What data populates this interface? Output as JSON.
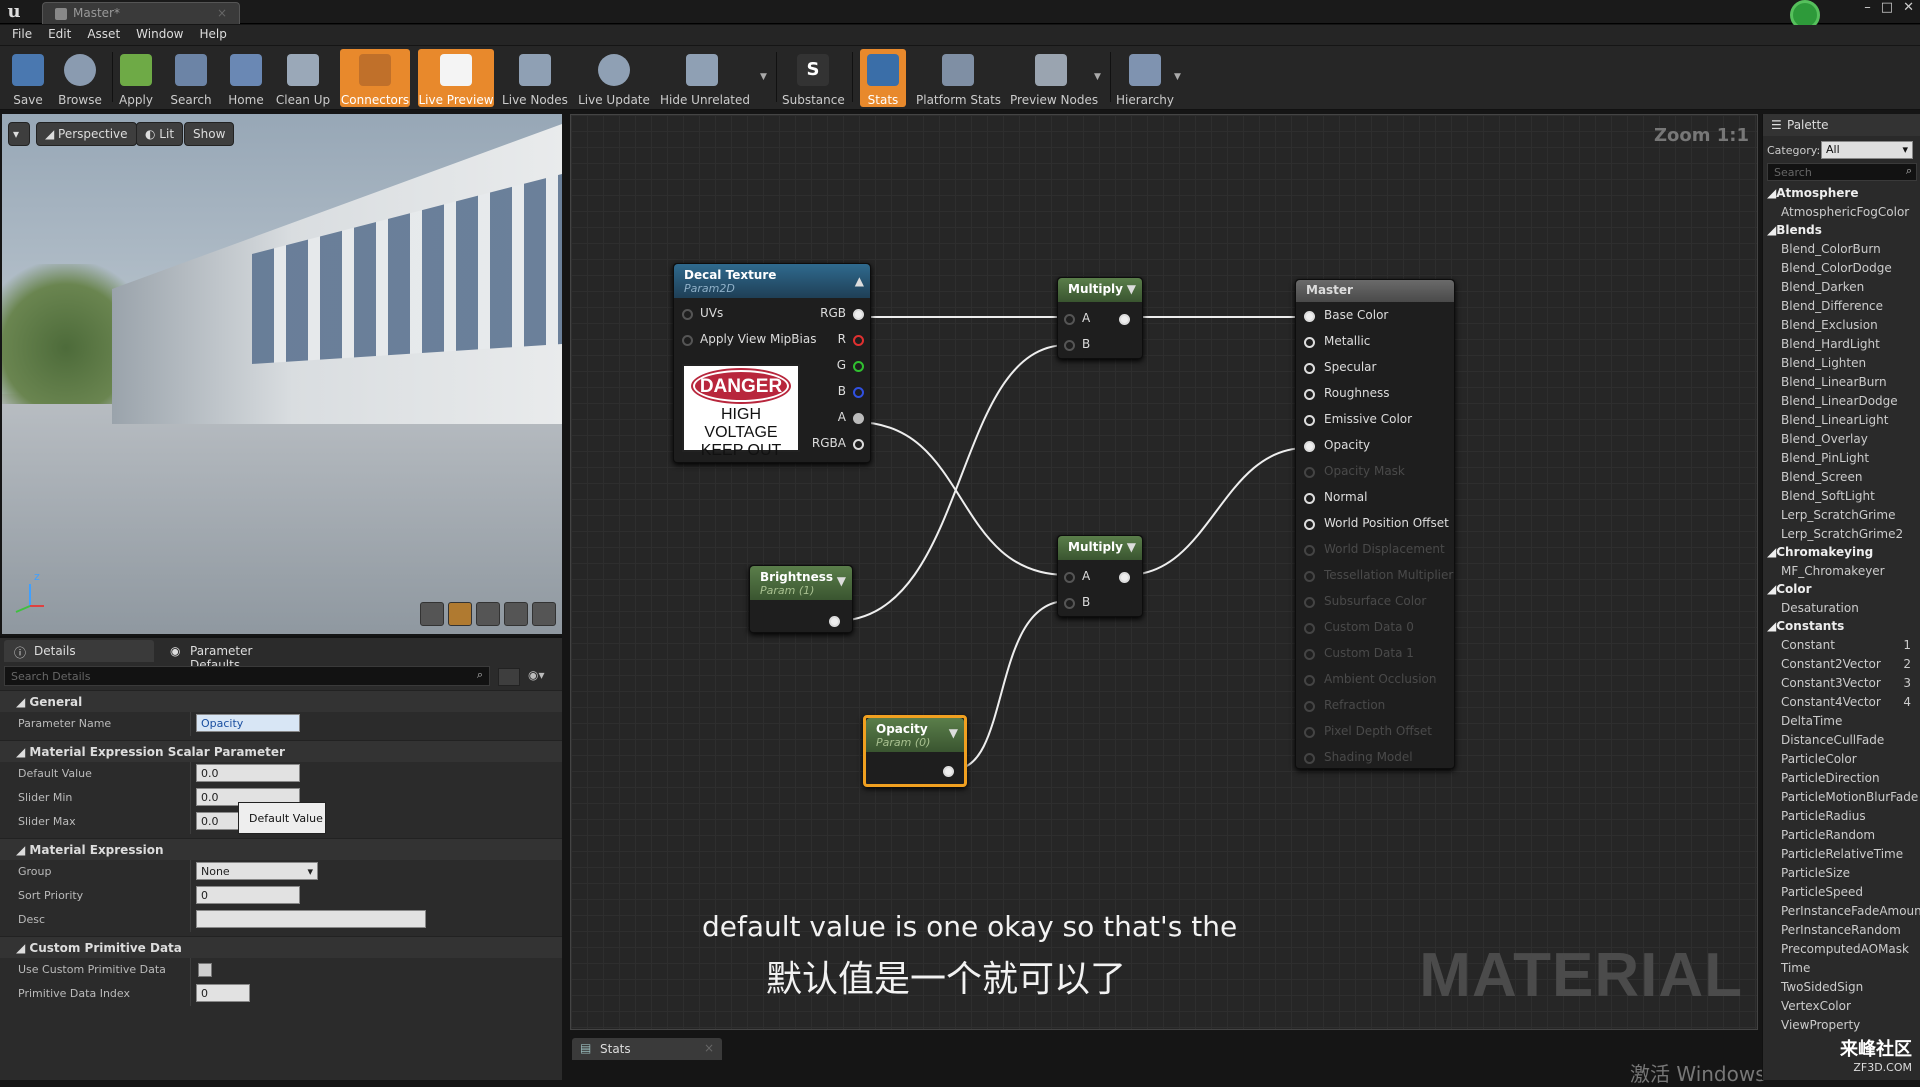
{
  "window": {
    "title": "Master*"
  },
  "menu": [
    "File",
    "Edit",
    "Asset",
    "Window",
    "Help"
  ],
  "toolbar": [
    {
      "label": "Save",
      "icon": "save-icon"
    },
    {
      "label": "Browse",
      "icon": "browse-icon"
    },
    {
      "label": "Apply",
      "icon": "apply-check-icon"
    },
    {
      "label": "Search",
      "icon": "search-icon"
    },
    {
      "label": "Home",
      "icon": "home-icon"
    },
    {
      "label": "Clean Up",
      "icon": "clean-up-icon"
    },
    {
      "label": "Connectors",
      "icon": "connectors-icon",
      "active": true
    },
    {
      "label": "Live Preview",
      "icon": "live-preview-icon",
      "active": true
    },
    {
      "label": "Live Nodes",
      "icon": "live-nodes-icon"
    },
    {
      "label": "Live Update",
      "icon": "live-update-icon"
    },
    {
      "label": "Hide Unrelated",
      "icon": "hide-unrelated-icon"
    },
    {
      "label": "Substance",
      "icon": "substance-icon"
    },
    {
      "label": "Stats",
      "icon": "stats-icon",
      "active": true
    },
    {
      "label": "Platform Stats",
      "icon": "platform-stats-icon"
    },
    {
      "label": "Preview Nodes",
      "icon": "preview-nodes-icon"
    },
    {
      "label": "Hierarchy",
      "icon": "hierarchy-icon"
    }
  ],
  "viewport": {
    "perspective": "Perspective",
    "lit": "Lit",
    "show": "Show",
    "axis": "z"
  },
  "details": {
    "tabs": [
      "Details",
      "Parameter Defaults"
    ],
    "search_placeholder": "Search Details",
    "sections": {
      "general": "General",
      "scalar": "Material Expression Scalar Parameter",
      "expression": "Material Expression",
      "custom": "Custom Primitive Data"
    },
    "rows": {
      "param_name_label": "Parameter Name",
      "param_name_value": "Opacity",
      "default_label": "Default Value",
      "default_value": "0.0",
      "slider_min_label": "Slider Min",
      "slider_min_value": "0.0",
      "slider_max_label": "Slider Max",
      "slider_max_value": "0.0",
      "group_label": "Group",
      "group_value": "None",
      "sort_label": "Sort Priority",
      "sort_value": "0",
      "desc_label": "Desc",
      "use_custom_label": "Use Custom Primitive Data",
      "prim_index_label": "Primitive Data Index",
      "prim_index_value": "0"
    },
    "tooltip": "Default Value"
  },
  "graph": {
    "zoom": "Zoom 1:1",
    "watermark": "MATERIAL",
    "decal": {
      "title": "Decal Texture",
      "subtitle": "Param2D",
      "in": [
        "UVs",
        "Apply View MipBias"
      ],
      "out": [
        "RGB",
        "R",
        "G",
        "B",
        "A",
        "RGBA"
      ],
      "sign": {
        "line1": "DANGER",
        "line2": "HIGH VOLTAGE",
        "line3": "KEEP OUT"
      }
    },
    "multiply1": {
      "title": "Multiply",
      "a": "A",
      "b": "B"
    },
    "multiply2": {
      "title": "Multiply",
      "a": "A",
      "b": "B"
    },
    "brightness": {
      "title": "Brightness",
      "subtitle": "Param (1)"
    },
    "opacity": {
      "title": "Opacity",
      "subtitle": "Param (0)"
    },
    "master": {
      "title": "Master",
      "pins": [
        {
          "label": "Base Color",
          "on": true
        },
        {
          "label": "Metallic",
          "on": true
        },
        {
          "label": "Specular",
          "on": true
        },
        {
          "label": "Roughness",
          "on": true
        },
        {
          "label": "Emissive Color",
          "on": true
        },
        {
          "label": "Opacity",
          "on": true
        },
        {
          "label": "Opacity Mask",
          "on": false
        },
        {
          "label": "Normal",
          "on": true
        },
        {
          "label": "World Position Offset",
          "on": true
        },
        {
          "label": "World Displacement",
          "on": false
        },
        {
          "label": "Tessellation Multiplier",
          "on": false
        },
        {
          "label": "Subsurface Color",
          "on": false
        },
        {
          "label": "Custom Data 0",
          "on": false
        },
        {
          "label": "Custom Data 1",
          "on": false
        },
        {
          "label": "Ambient Occlusion",
          "on": false
        },
        {
          "label": "Refraction",
          "on": false
        },
        {
          "label": "Pixel Depth Offset",
          "on": false
        },
        {
          "label": "Shading Model",
          "on": false
        }
      ]
    }
  },
  "subtitles": {
    "en": "default value is one okay so that's the",
    "zh": "默认值是一个就可以了"
  },
  "stats_tab": "Stats",
  "os_watermark": "激活 Windows",
  "palette": {
    "title": "Palette",
    "category_label": "Category:",
    "category_value": "All",
    "search_placeholder": "Search",
    "list": [
      {
        "g": "Atmosphere"
      },
      {
        "i": "AtmosphericFogColor"
      },
      {
        "g": "Blends"
      },
      {
        "i": "Blend_ColorBurn"
      },
      {
        "i": "Blend_ColorDodge"
      },
      {
        "i": "Blend_Darken"
      },
      {
        "i": "Blend_Difference"
      },
      {
        "i": "Blend_Exclusion"
      },
      {
        "i": "Blend_HardLight"
      },
      {
        "i": "Blend_Lighten"
      },
      {
        "i": "Blend_LinearBurn"
      },
      {
        "i": "Blend_LinearDodge"
      },
      {
        "i": "Blend_LinearLight"
      },
      {
        "i": "Blend_Overlay"
      },
      {
        "i": "Blend_PinLight"
      },
      {
        "i": "Blend_Screen"
      },
      {
        "i": "Blend_SoftLight"
      },
      {
        "i": "Lerp_ScratchGrime"
      },
      {
        "i": "Lerp_ScratchGrime2"
      },
      {
        "g": "Chromakeying"
      },
      {
        "i": "MF_Chromakeyer"
      },
      {
        "g": "Color"
      },
      {
        "i": "Desaturation"
      },
      {
        "g": "Constants"
      },
      {
        "i": "Constant",
        "k": "1"
      },
      {
        "i": "Constant2Vector",
        "k": "2"
      },
      {
        "i": "Constant3Vector",
        "k": "3"
      },
      {
        "i": "Constant4Vector",
        "k": "4"
      },
      {
        "i": "DeltaTime"
      },
      {
        "i": "DistanceCullFade"
      },
      {
        "i": "ParticleColor"
      },
      {
        "i": "ParticleDirection"
      },
      {
        "i": "ParticleMotionBlurFade"
      },
      {
        "i": "ParticleRadius"
      },
      {
        "i": "ParticleRandom"
      },
      {
        "i": "ParticleRelativeTime"
      },
      {
        "i": "ParticleSize"
      },
      {
        "i": "ParticleSpeed"
      },
      {
        "i": "PerInstanceFadeAmount"
      },
      {
        "i": "PerInstanceRandom"
      },
      {
        "i": "PrecomputedAOMask"
      },
      {
        "i": "Time"
      },
      {
        "i": "TwoSidedSign"
      },
      {
        "i": "VertexColor"
      },
      {
        "i": "ViewProperty"
      }
    ],
    "logo": "来峰社区",
    "logo_sub": "ZF3D.COM"
  },
  "colors": {
    "accent": "#e8892c",
    "node_green": "#4a6a3a",
    "node_blue": "#2a5a7a",
    "selected": "#f0a020"
  }
}
